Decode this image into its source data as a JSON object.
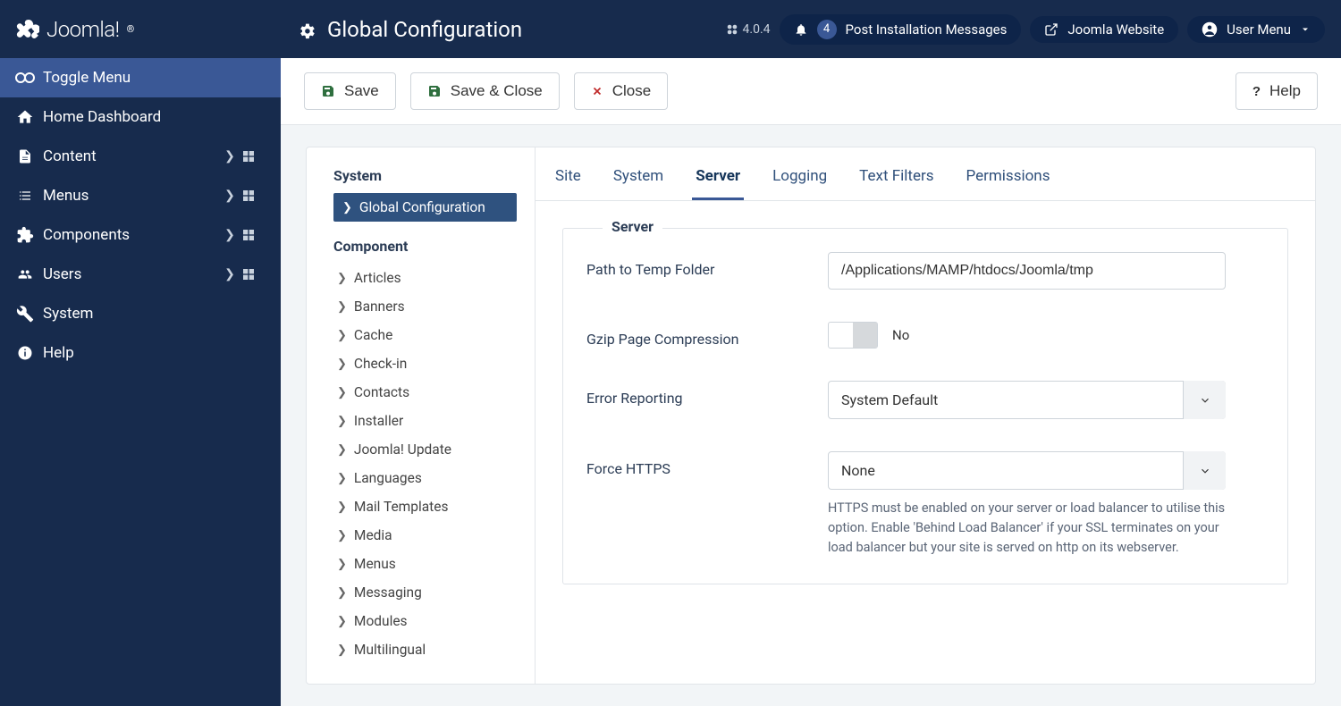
{
  "header": {
    "brand": "Joomla!",
    "page_title": "Global Configuration",
    "version": "4.0.4",
    "notif_count": "4",
    "post_install": "Post Installation Messages",
    "joomla_website": "Joomla Website",
    "user_menu": "User Menu"
  },
  "sidebar": {
    "toggle": "Toggle Menu",
    "items": [
      {
        "label": "Home Dashboard",
        "icon": "home",
        "has_sub": false,
        "has_grid": false
      },
      {
        "label": "Content",
        "icon": "file",
        "has_sub": true,
        "has_grid": true
      },
      {
        "label": "Menus",
        "icon": "list",
        "has_sub": true,
        "has_grid": true
      },
      {
        "label": "Components",
        "icon": "puzzle",
        "has_sub": true,
        "has_grid": true
      },
      {
        "label": "Users",
        "icon": "users",
        "has_sub": true,
        "has_grid": true
      },
      {
        "label": "System",
        "icon": "wrench",
        "has_sub": false,
        "has_grid": false
      },
      {
        "label": "Help",
        "icon": "info",
        "has_sub": false,
        "has_grid": false
      }
    ]
  },
  "toolbar": {
    "save": "Save",
    "save_close": "Save & Close",
    "close": "Close",
    "help": "Help"
  },
  "leftcol": {
    "system_heading": "System",
    "global_config": "Global Configuration",
    "component_heading": "Component",
    "components": [
      "Articles",
      "Banners",
      "Cache",
      "Check-in",
      "Contacts",
      "Installer",
      "Joomla! Update",
      "Languages",
      "Mail Templates",
      "Media",
      "Menus",
      "Messaging",
      "Modules",
      "Multilingual"
    ]
  },
  "tabs": [
    "Site",
    "System",
    "Server",
    "Logging",
    "Text Filters",
    "Permissions"
  ],
  "active_tab": "Server",
  "form": {
    "legend": "Server",
    "path_label": "Path to Temp Folder",
    "path_value": "/Applications/MAMP/htdocs/Joomla/tmp",
    "gzip_label": "Gzip Page Compression",
    "gzip_value": "No",
    "error_label": "Error Reporting",
    "error_value": "System Default",
    "https_label": "Force HTTPS",
    "https_value": "None",
    "https_help": "HTTPS must be enabled on your server or load balancer to utilise this option. Enable 'Behind Load Balancer' if your SSL terminates on your load balancer but your site is served on http on its webserver."
  }
}
